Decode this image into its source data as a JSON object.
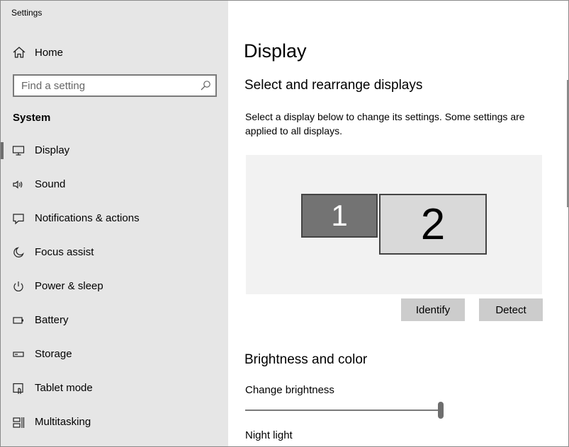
{
  "window": {
    "app_title": "Settings",
    "controls": [
      "minimize",
      "maximize",
      "close"
    ]
  },
  "sidebar": {
    "home_label": "Home",
    "search_placeholder": "Find a setting",
    "section_title": "System",
    "selected": "Display",
    "items": [
      {
        "label": "Display",
        "icon": "monitor-icon"
      },
      {
        "label": "Sound",
        "icon": "speaker-icon"
      },
      {
        "label": "Notifications & actions",
        "icon": "message-icon"
      },
      {
        "label": "Focus assist",
        "icon": "moon-icon"
      },
      {
        "label": "Power & sleep",
        "icon": "power-icon"
      },
      {
        "label": "Battery",
        "icon": "battery-icon"
      },
      {
        "label": "Storage",
        "icon": "storage-icon"
      },
      {
        "label": "Tablet mode",
        "icon": "tablet-icon"
      },
      {
        "label": "Multitasking",
        "icon": "multitasking-icon"
      }
    ]
  },
  "main": {
    "page_title": "Display",
    "arrange_heading": "Select and rearrange displays",
    "arrange_description": "Select a display below to change its settings. Some settings are applied to all displays.",
    "monitors": [
      {
        "number": "1",
        "selected": true
      },
      {
        "number": "2",
        "selected": false
      }
    ],
    "identify_label": "Identify",
    "detect_label": "Detect",
    "brightness_heading": "Brightness and color",
    "brightness_label": "Change brightness",
    "brightness_value_fraction": 1.0,
    "night_light_label": "Night light"
  },
  "colors": {
    "sidebar_bg": "#e6e6e6",
    "arrange_bg": "#f2f2f2",
    "monitor_selected": "#737373",
    "monitor_unselected": "#d9d9d9",
    "button_bg": "#cccccc"
  }
}
